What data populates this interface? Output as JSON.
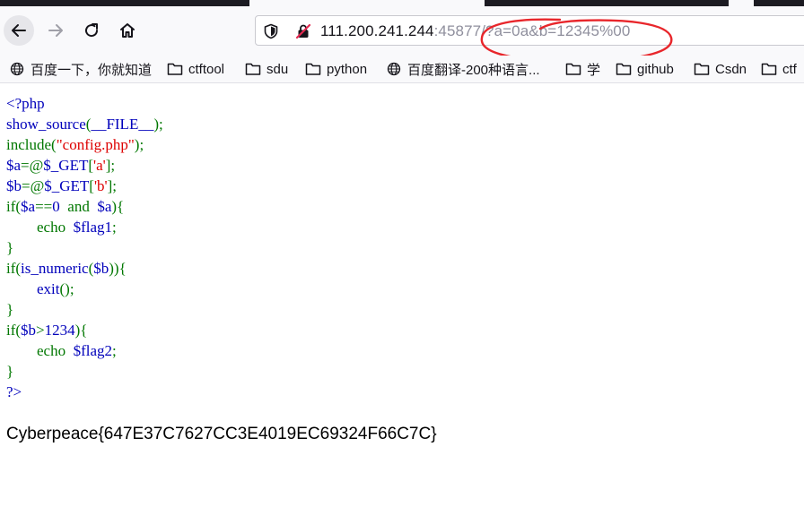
{
  "browser": {
    "url_host": "111.200.241.244",
    "url_port": ":45877",
    "url_path": "/?a=0a&b=12345%00",
    "colors": {
      "annotation": "#e8262b",
      "toolbar_bg": "#f9f9fb"
    }
  },
  "bookmarks": [
    {
      "label": "百度一下，你就知道",
      "icon": "globe-icon"
    },
    {
      "label": "ctftool",
      "icon": "folder-icon"
    },
    {
      "label": "sdu",
      "icon": "folder-icon"
    },
    {
      "label": "python",
      "icon": "folder-icon"
    },
    {
      "label": "百度翻译-200种语言...",
      "icon": "globe-icon"
    },
    {
      "label": "学",
      "icon": "folder-icon"
    },
    {
      "label": "github",
      "icon": "folder-icon"
    },
    {
      "label": "Csdn",
      "icon": "folder-icon"
    },
    {
      "label": "ctf",
      "icon": "folder-icon"
    }
  ],
  "source": {
    "l1": "<?php",
    "l2_fn": "show_source",
    "l2_a": "(",
    "l2_c": "__FILE__",
    "l2_b": ");",
    "l3_fn": "include",
    "l3_a": "(",
    "l3_s": "\"config.php\"",
    "l3_b": ");",
    "l4_v": "$a",
    "l4_op": "=@",
    "l4_g": "$_GET",
    "l4_o": "[",
    "l4_s": "'a'",
    "l4_c": "];",
    "l5_v": "$b",
    "l5_op": "=@",
    "l5_g": "$_GET",
    "l5_o": "[",
    "l5_s": "'b'",
    "l5_c": "];",
    "l6_kw": "if(",
    "l6_v": "$a",
    "l6_op": "==",
    "l6_n": "0",
    "l6_and": "and",
    "l6_v2": "$a",
    "l6_end": "){",
    "l7_kw": "echo",
    "l7_v": "$flag1",
    "l7_end": ";",
    "l8": "}",
    "l9_kw": "if(",
    "l9_fn": "is_numeric",
    "l9_a": "(",
    "l9_v": "$b",
    "l9_end": ")){",
    "l10_fn": "exit",
    "l10_end": "();",
    "l11": "}",
    "l12_kw": "if(",
    "l12_v": "$b",
    "l12_op": ">",
    "l12_n": "1234",
    "l12_end": "){",
    "l13_kw": "echo",
    "l13_v": "$flag2",
    "l13_end": ";",
    "l14": "}",
    "l15": "?>"
  },
  "output": {
    "flag": "Cyberpeace{647E37C7627CC3E4019EC69324F66C7C}"
  }
}
